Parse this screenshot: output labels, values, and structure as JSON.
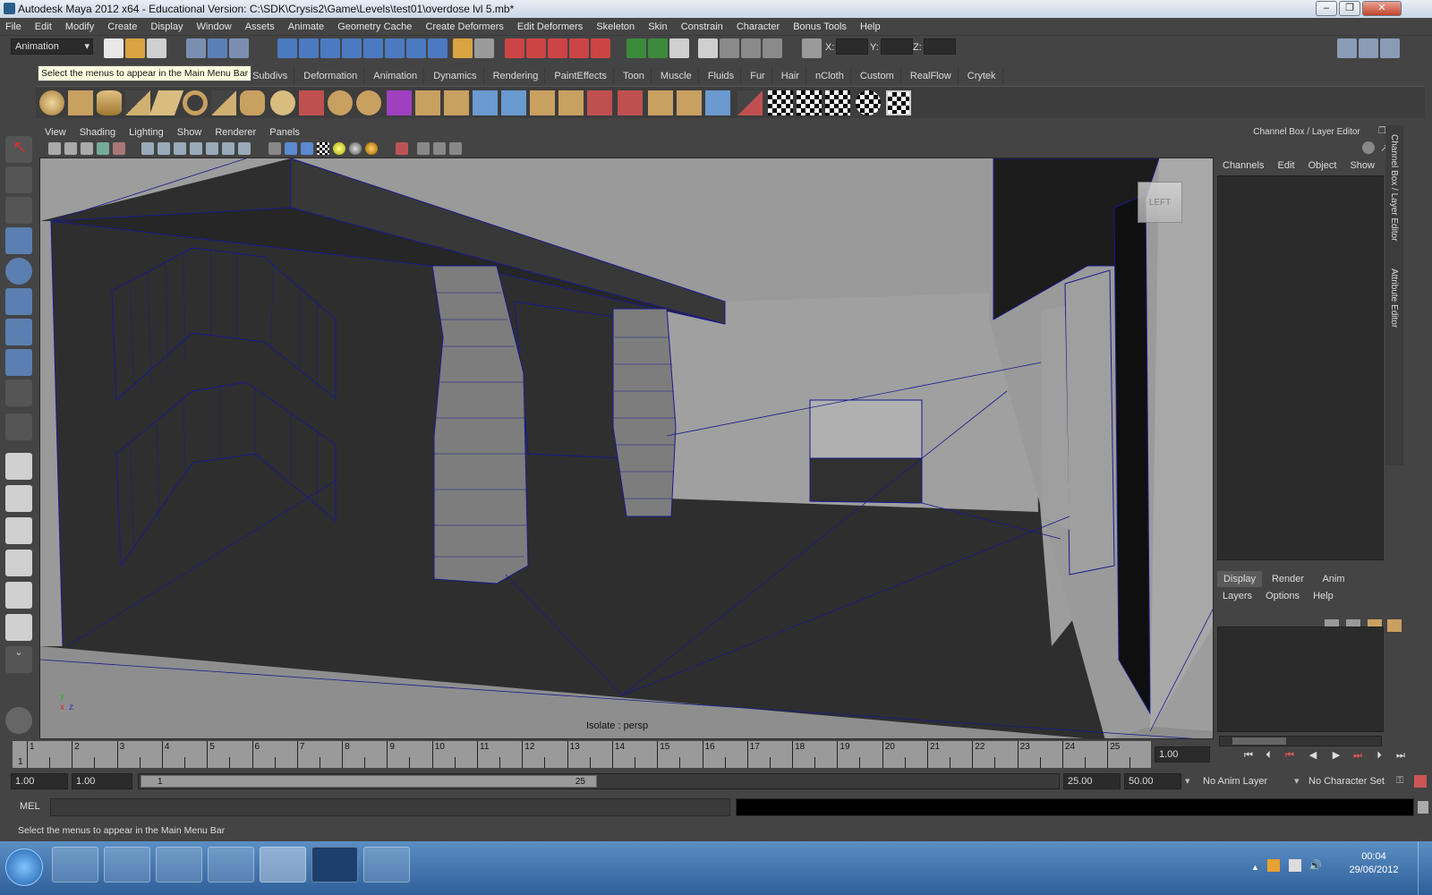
{
  "window": {
    "title": "Autodesk Maya 2012 x64 - Educational Version: C:\\SDK\\Crysis2\\Game\\Levels\\test01\\overdose lvl 5.mb*"
  },
  "menubar": [
    "File",
    "Edit",
    "Modify",
    "Create",
    "Display",
    "Window",
    "Assets",
    "Animate",
    "Geometry Cache",
    "Create Deformers",
    "Edit Deformers",
    "Skeleton",
    "Skin",
    "Constrain",
    "Character",
    "Bonus Tools",
    "Help"
  ],
  "statusline": {
    "mode": "Animation",
    "x_label": "X:",
    "y_label": "Y:",
    "z_label": "Z:"
  },
  "shelf": {
    "tooltip": "Select the menus to appear in the Main Menu Bar",
    "tabs": [
      "Subdivs",
      "Deformation",
      "Animation",
      "Dynamics",
      "Rendering",
      "PaintEffects",
      "Toon",
      "Muscle",
      "Fluids",
      "Fur",
      "Hair",
      "nCloth",
      "Custom",
      "RealFlow",
      "Crytek"
    ]
  },
  "viewport": {
    "menu": [
      "View",
      "Shading",
      "Lighting",
      "Show",
      "Renderer",
      "Panels"
    ],
    "label": "Isolate : persp",
    "viewcube": "LEFT",
    "axis_y": "y",
    "axis_x": "x",
    "axis_z": "z"
  },
  "channelbox": {
    "title": "Channel Box / Layer Editor",
    "menu": [
      "Channels",
      "Edit",
      "Object",
      "Show"
    ],
    "layer_tabs": [
      "Display",
      "Render",
      "Anim"
    ],
    "layer_menu": [
      "Layers",
      "Options",
      "Help"
    ]
  },
  "sidetabs": [
    "Channel Box / Layer Editor",
    "Attribute Editor"
  ],
  "timeslider": {
    "ticks": [
      "1",
      "2",
      "3",
      "4",
      "5",
      "6",
      "7",
      "8",
      "9",
      "10",
      "11",
      "12",
      "13",
      "14",
      "15",
      "16",
      "17",
      "18",
      "19",
      "20",
      "21",
      "22",
      "23",
      "24",
      "25"
    ],
    "current_marker": "1",
    "current_frame": "1.00"
  },
  "rangeslider": {
    "start_anim": "1.00",
    "start_range": "1.00",
    "range_left": "1",
    "range_right": "25",
    "end_range": "25.00",
    "end_anim": "50.00",
    "anim_layer": "No Anim Layer",
    "character_set": "No Character Set"
  },
  "cmdline": {
    "label": "MEL"
  },
  "helpline": {
    "text": "Select the menus to appear in the Main Menu Bar"
  },
  "taskbar": {
    "time": "00:04",
    "date": "29/06/2012"
  },
  "colors": {
    "ui_bg": "#444444",
    "panel_dark": "#2b2b2b",
    "viewport_bg": "#9d9d9d",
    "wire_blue": "#1a1a8c",
    "taskbar": "#3b6ea8"
  }
}
